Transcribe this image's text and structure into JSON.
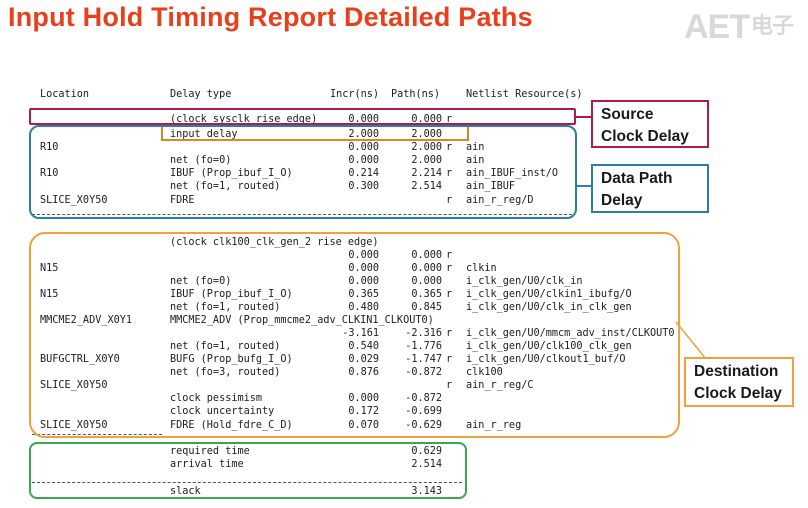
{
  "title": "Input Hold Timing Report Detailed Paths",
  "logo": {
    "text": "AET",
    "symbol": "电子"
  },
  "header": {
    "location": "Location",
    "delay_type": "Delay type",
    "incr": "Incr(ns)",
    "path": "Path(ns)",
    "netlist": "Netlist Resource(s)"
  },
  "rows": [
    {
      "loc": "",
      "type": "(clock sysclk rise edge)",
      "incr": "0.000",
      "path": "0.000",
      "edge": "r",
      "res": ""
    },
    {
      "loc": "",
      "type": "input delay",
      "incr": "2.000",
      "path": "2.000",
      "edge": "",
      "res": ""
    },
    {
      "loc": "R10",
      "type": "",
      "incr": "0.000",
      "path": "2.000",
      "edge": "r",
      "res": "ain"
    },
    {
      "loc": "",
      "type": "net (fo=0)",
      "incr": "0.000",
      "path": "2.000",
      "edge": "",
      "res": "ain"
    },
    {
      "loc": "R10",
      "type": "IBUF (Prop_ibuf_I_O)",
      "incr": "0.214",
      "path": "2.214",
      "edge": "r",
      "res": "ain_IBUF_inst/O"
    },
    {
      "loc": "",
      "type": "net (fo=1, routed)",
      "incr": "0.300",
      "path": "2.514",
      "edge": "",
      "res": "ain_IBUF"
    },
    {
      "loc": "SLICE_X0Y50",
      "type": "FDRE",
      "incr": "",
      "path": "",
      "edge": "r",
      "res": "ain_r_reg/D"
    },
    {
      "loc": "",
      "type": "(clock clk100_clk_gen_2 rise edge)",
      "incr": "",
      "path": "",
      "edge": "",
      "res": ""
    },
    {
      "loc": "",
      "type": "",
      "incr": "0.000",
      "path": "0.000",
      "edge": "r",
      "res": ""
    },
    {
      "loc": "N15",
      "type": "",
      "incr": "0.000",
      "path": "0.000",
      "edge": "r",
      "res": "clkin"
    },
    {
      "loc": "",
      "type": "net (fo=0)",
      "incr": "0.000",
      "path": "0.000",
      "edge": "",
      "res": "i_clk_gen/U0/clk_in"
    },
    {
      "loc": "N15",
      "type": "IBUF (Prop_ibuf_I_O)",
      "incr": "0.365",
      "path": "0.365",
      "edge": "r",
      "res": "i_clk_gen/U0/clkin1_ibufg/O"
    },
    {
      "loc": "",
      "type": "net (fo=1, routed)",
      "incr": "0.480",
      "path": "0.845",
      "edge": "",
      "res": "i_clk_gen/U0/clk_in_clk_gen"
    },
    {
      "loc": "MMCME2_ADV_X0Y1",
      "type": "MMCME2_ADV (Prop_mmcme2_adv_CLKIN1_CLKOUT0)",
      "incr": "",
      "path": "",
      "edge": "",
      "res": ""
    },
    {
      "loc": "",
      "type": "",
      "incr": "-3.161",
      "path": "-2.316",
      "edge": "r",
      "res": "i_clk_gen/U0/mmcm_adv_inst/CLKOUT0"
    },
    {
      "loc": "",
      "type": "net (fo=1, routed)",
      "incr": "0.540",
      "path": "-1.776",
      "edge": "",
      "res": "i_clk_gen/U0/clk100_clk_gen"
    },
    {
      "loc": "BUFGCTRL_X0Y0",
      "type": "BUFG (Prop_bufg_I_O)",
      "incr": "0.029",
      "path": "-1.747",
      "edge": "r",
      "res": "i_clk_gen/U0/clkout1_buf/O"
    },
    {
      "loc": "",
      "type": "net (fo=3, routed)",
      "incr": "0.876",
      "path": "-0.872",
      "edge": "",
      "res": "clk100"
    },
    {
      "loc": "SLICE_X0Y50",
      "type": "",
      "incr": "",
      "path": "",
      "edge": "r",
      "res": "ain_r_reg/C"
    },
    {
      "loc": "",
      "type": "clock pessimism",
      "incr": "0.000",
      "path": "-0.872",
      "edge": "",
      "res": ""
    },
    {
      "loc": "",
      "type": "clock uncertainty",
      "incr": "0.172",
      "path": "-0.699",
      "edge": "",
      "res": ""
    },
    {
      "loc": "SLICE_X0Y50",
      "type": "FDRE (Hold_fdre_C_D)",
      "incr": "0.070",
      "path": "-0.629",
      "edge": "",
      "res": "ain_r_reg"
    }
  ],
  "summary": [
    {
      "type": "required time",
      "path": "0.629"
    },
    {
      "type": "arrival time",
      "path": "2.514"
    },
    {
      "type": "slack",
      "path": "3.143"
    }
  ],
  "callouts": {
    "source": [
      "Source",
      "Clock Delay"
    ],
    "data": [
      "Data Path",
      "Delay"
    ],
    "dest": [
      "Destination",
      "Clock Delay"
    ]
  },
  "colors": {
    "title": "#e8401c",
    "source": "#b01a4f",
    "data": "#2b7fa5",
    "dest": "#f0a040",
    "slack": "#35a855",
    "input_delay_highlight": "#d98a1e"
  }
}
